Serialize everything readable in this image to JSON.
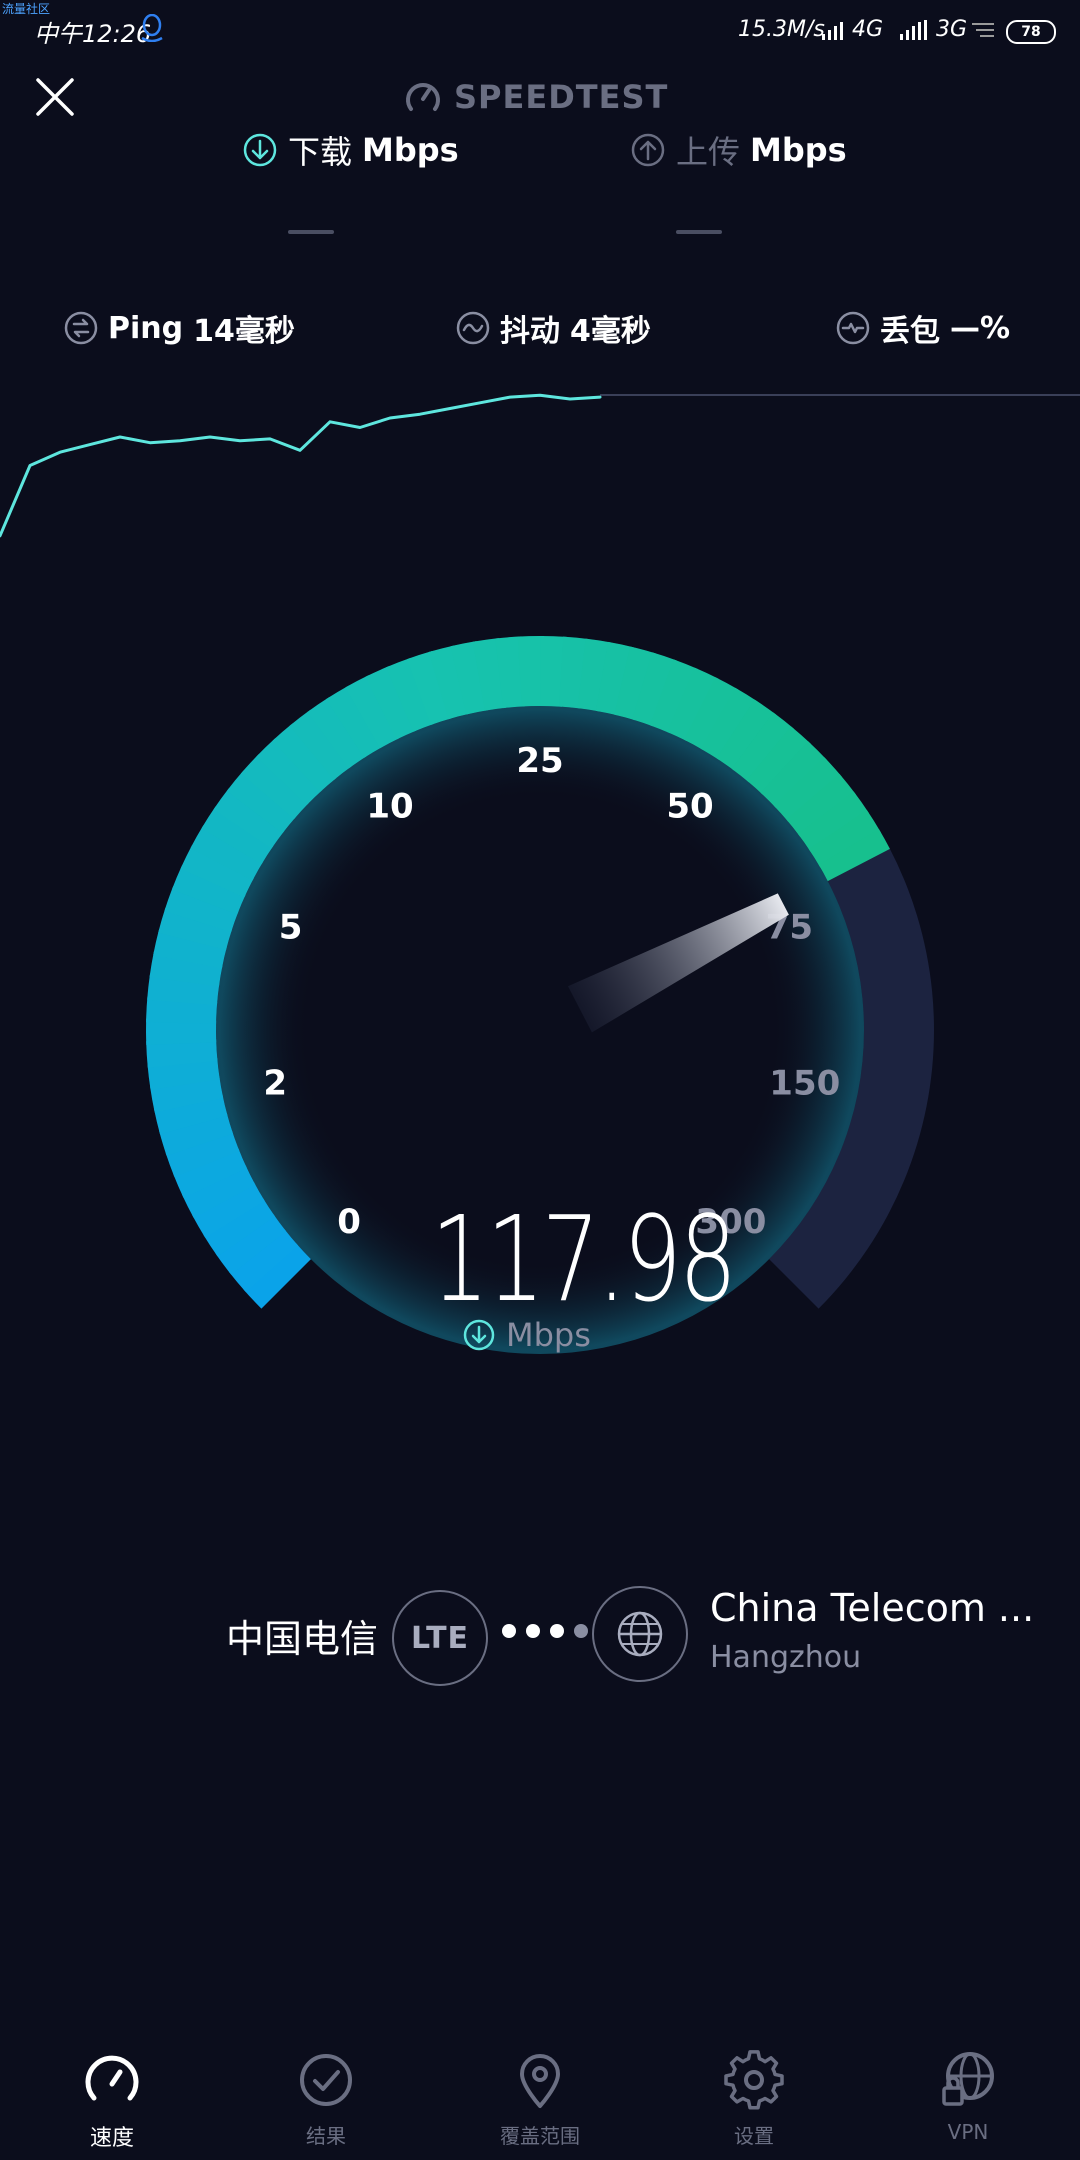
{
  "status_bar": {
    "watermark": "流量社区",
    "time": "中午12:26",
    "net_speed": "15.3M/s",
    "net_4g": "4G",
    "net_3g": "3G",
    "battery": "78"
  },
  "header": {
    "brand": "SPEEDTEST"
  },
  "tabs": {
    "download": {
      "label_cn": "下载",
      "label_unit": "Mbps",
      "value": "—"
    },
    "upload": {
      "label_cn": "上传",
      "label_unit": "Mbps",
      "value": "—"
    }
  },
  "metrics": {
    "ping": {
      "label": "Ping",
      "value": "14毫秒"
    },
    "jitter": {
      "label": "抖动",
      "value": "4毫秒"
    },
    "loss": {
      "label": "丢包",
      "value": "—%"
    }
  },
  "speed_graph": {
    "values": [
      0.18,
      0.55,
      0.62,
      0.66,
      0.7,
      0.67,
      0.68,
      0.7,
      0.68,
      0.69,
      0.63,
      0.78,
      0.75,
      0.8,
      0.82,
      0.85,
      0.88,
      0.91,
      0.92,
      0.9,
      0.91
    ]
  },
  "gauge": {
    "ticks": [
      "0",
      "2",
      "5",
      "10",
      "25",
      "50",
      "75",
      "150",
      "300"
    ],
    "current_value": 117.98,
    "needle_fraction": 0.732,
    "colors": {
      "start": "#0aa3ea",
      "mid": "#17c2b0",
      "end": "#17c08d",
      "track": "#1c2340"
    }
  },
  "speed_value": "117.98",
  "speed_unit": "Mbps",
  "connection": {
    "carrier": "中国电信",
    "network_type": "LTE",
    "server_name": "China Telecom ...",
    "server_city": "Hangzhou"
  },
  "bottom_nav": [
    {
      "label": "速度",
      "icon": "speedometer-icon",
      "active": true
    },
    {
      "label": "结果",
      "icon": "check-circle-icon",
      "active": false
    },
    {
      "label": "覆盖范围",
      "icon": "map-pin-icon",
      "active": false
    },
    {
      "label": "设置",
      "icon": "gear-icon",
      "active": false
    },
    {
      "label": "VPN",
      "icon": "vpn-globe-lock-icon",
      "active": false
    }
  ]
}
